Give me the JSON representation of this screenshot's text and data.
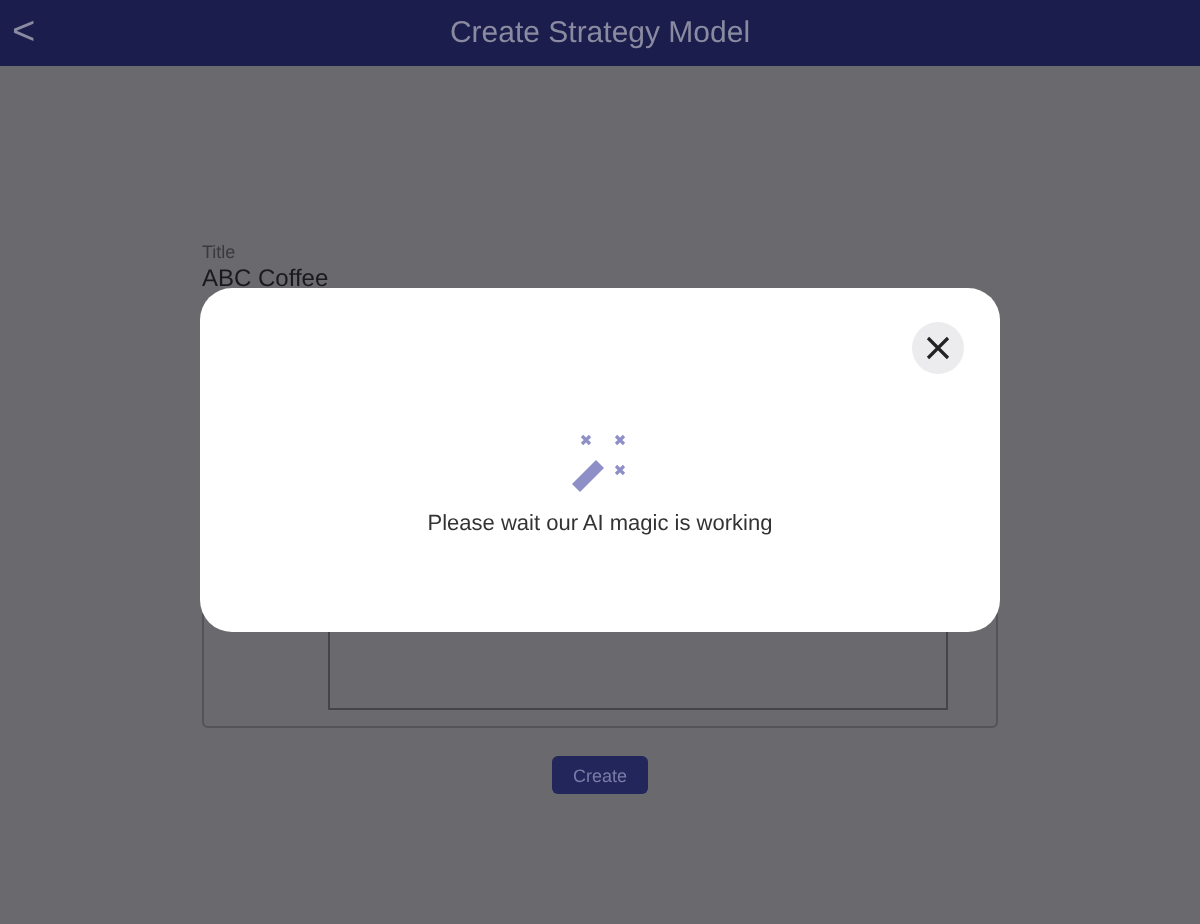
{
  "header": {
    "title": "Create Strategy Model",
    "back_icon": "<"
  },
  "form": {
    "title_label": "Title",
    "title_value": "ABC Coffee"
  },
  "create_button": "Create",
  "dialog": {
    "message": "Please wait our AI magic is working"
  }
}
